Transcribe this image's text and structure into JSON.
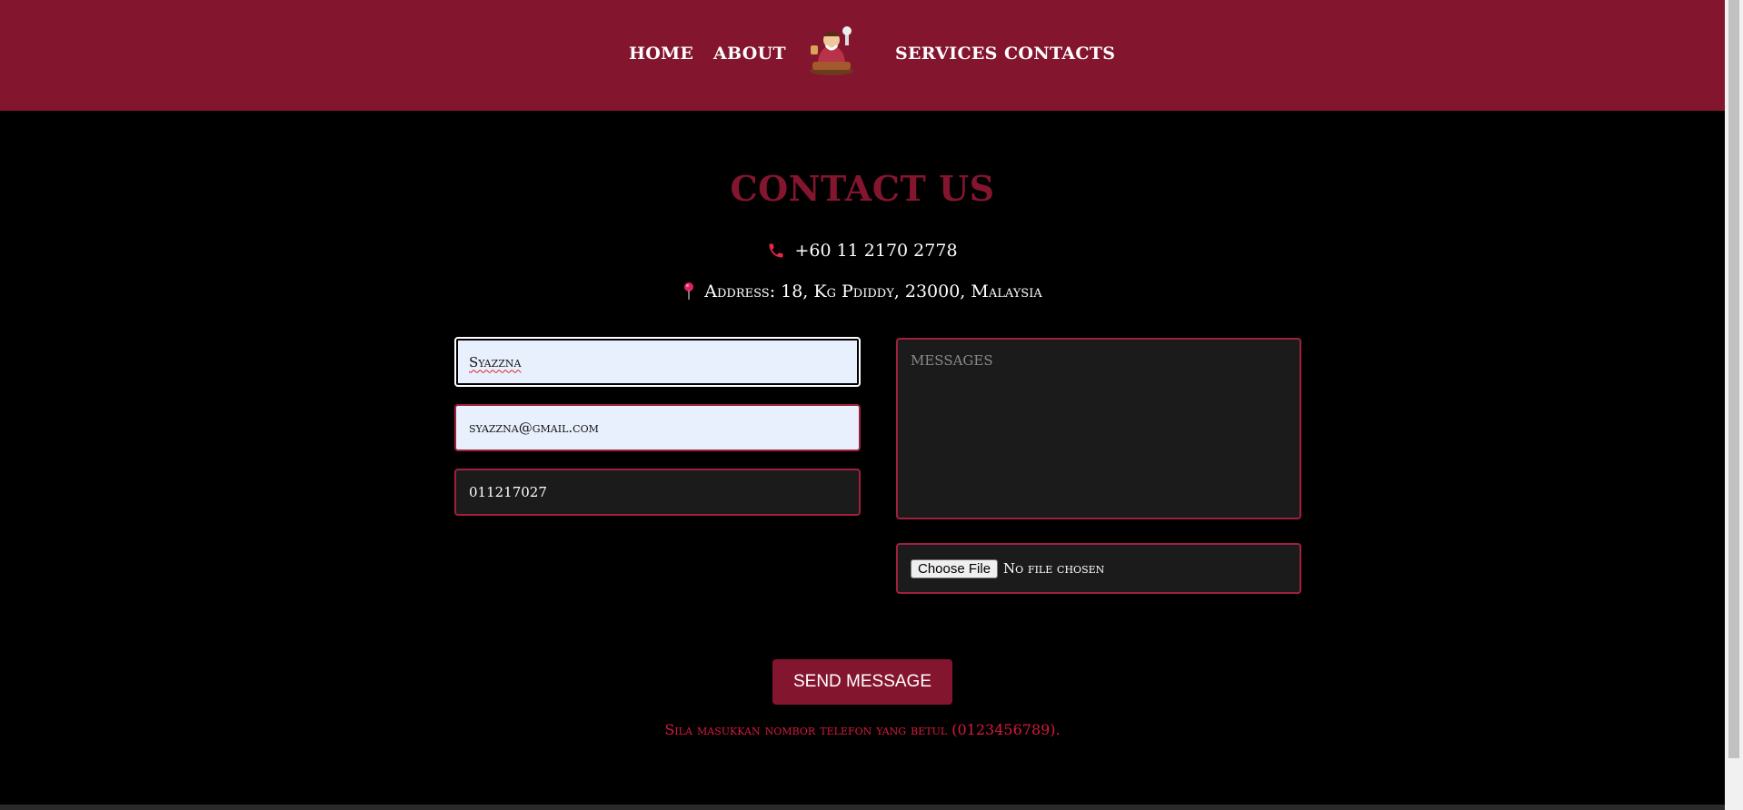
{
  "nav": {
    "home": "HOME",
    "about": "ABOUT",
    "services": "SERVICES",
    "contacts": "CONTACTS",
    "logo_icon": "mascot-logo-icon"
  },
  "contact": {
    "title": "CONTACT US",
    "phone": "+60 11 2170 2778",
    "address": "Address: 18, Kg Pdiddy, 23000, Malaysia",
    "phone_icon": "phone-icon",
    "address_icon": "map-pin-icon"
  },
  "form": {
    "name_value": "Syazzna",
    "email_value": "syazzna@gmail.com",
    "phone_value": "011217027",
    "messages_placeholder": "MESSAGES",
    "file_button": "Choose File",
    "file_status": "No file chosen",
    "send_label": "SEND MESSAGE",
    "error_text": "Sila masukkan nombor telefon yang betul (0123456789)."
  },
  "colors": {
    "brand": "#84152e",
    "border": "#a0203d",
    "error": "#d61a3c",
    "background": "#000000"
  }
}
